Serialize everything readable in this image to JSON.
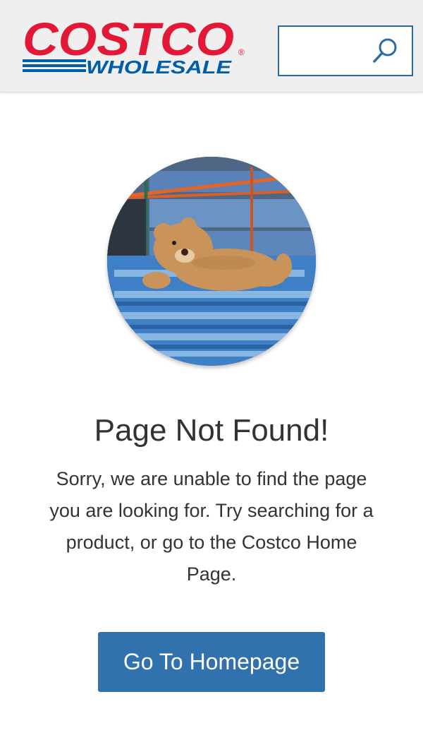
{
  "brand": {
    "name_top": "COSTCO",
    "name_bottom": "WHOLESALE",
    "registered_mark": "®",
    "red": "#e31837",
    "blue": "#005daa"
  },
  "search": {
    "value": "",
    "placeholder": "",
    "icon": "search-icon",
    "border_color": "#2a6ba6"
  },
  "hero_image": {
    "description_icon": "teddy-bear-photo",
    "shape": "circle"
  },
  "error": {
    "title": "Page Not Found!",
    "message": "Sorry, we are unable to find the page you are looking for. Try searching for a product, or go to the Costco Home Page."
  },
  "actions": {
    "home_button_label": "Go To Homepage",
    "button_color": "#3171ad"
  }
}
